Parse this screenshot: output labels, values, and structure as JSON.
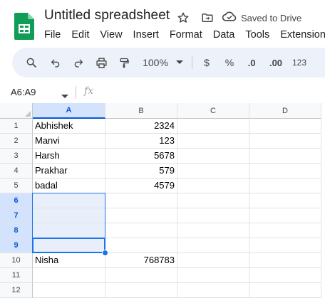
{
  "app": {
    "doc_title": "Untitled spreadsheet",
    "save_status": "Saved to Drive",
    "icons": [
      "sheets-logo-icon",
      "star-icon",
      "move-folder-icon",
      "cloud-saved-icon"
    ]
  },
  "menu": [
    "File",
    "Edit",
    "View",
    "Insert",
    "Format",
    "Data",
    "Tools",
    "Extensions"
  ],
  "toolbar": {
    "zoom": "100%",
    "currency": "$",
    "percent": "%",
    "decrease_decimal": ".0",
    "increase_decimal": ".00",
    "number_format": "123",
    "icons": [
      "search-icon",
      "undo-icon",
      "redo-icon",
      "print-icon",
      "paint-format-icon",
      "zoom-dropdown-icon"
    ]
  },
  "formula_bar": {
    "name_box": "A6:A9",
    "fx": "fx",
    "content": ""
  },
  "sheet": {
    "columns": [
      "A",
      "B",
      "C",
      "D"
    ],
    "selected_column": "A",
    "rows": [
      {
        "num": "1",
        "a": "Abhishek",
        "b": "2324"
      },
      {
        "num": "2",
        "a": "Manvi",
        "b": "123"
      },
      {
        "num": "3",
        "a": "Harsh",
        "b": "5678"
      },
      {
        "num": "4",
        "a": "Prakhar",
        "b": "579"
      },
      {
        "num": "5",
        "a": "badal",
        "b": "4579"
      },
      {
        "num": "6",
        "a": "",
        "b": ""
      },
      {
        "num": "7",
        "a": "",
        "b": ""
      },
      {
        "num": "8",
        "a": "",
        "b": ""
      },
      {
        "num": "9",
        "a": "",
        "b": ""
      },
      {
        "num": "10",
        "a": "Nisha",
        "b": "768783"
      },
      {
        "num": "11",
        "a": "",
        "b": ""
      },
      {
        "num": "12",
        "a": "",
        "b": ""
      }
    ],
    "selected_rows": [
      "6",
      "7",
      "8",
      "9"
    ],
    "selection_color": "#1a73e8"
  }
}
